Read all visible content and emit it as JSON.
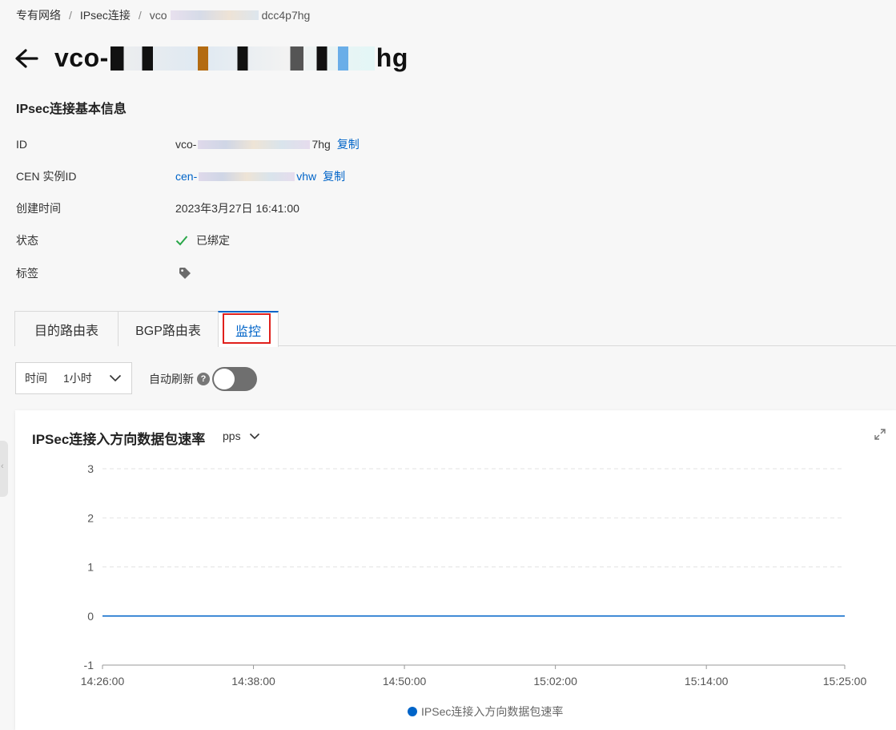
{
  "breadcrumb": {
    "items": [
      "专有网络",
      "IPsec连接",
      "vco"
    ],
    "tail": "dcc4p7hg"
  },
  "header": {
    "title_prefix": "vco-",
    "title_suffix": "hg"
  },
  "info": {
    "section_title": "IPsec连接基本信息",
    "id_label": "ID",
    "id_prefix": "vco-",
    "id_suffix": "7hg",
    "cen_label": "CEN 实例ID",
    "cen_prefix": "cen-",
    "cen_suffix": "vhw",
    "copy_label": "复制",
    "created_label": "创建时间",
    "created_value": "2023年3月27日 16:41:00",
    "status_label": "状态",
    "status_value": "已绑定",
    "tags_label": "标签"
  },
  "tabs": [
    {
      "label": "目的路由表"
    },
    {
      "label": "BGP路由表"
    },
    {
      "label": "监控"
    }
  ],
  "controls": {
    "time_label": "时间",
    "time_value": "1小时",
    "auto_refresh_label": "自动刷新",
    "help_glyph": "?",
    "auto_refresh_on": false
  },
  "chart": {
    "title": "IPSec连接入方向数据包速率",
    "unit": "pps",
    "legend": "IPSec连接入方向数据包速率"
  },
  "colors": {
    "accent": "#0064c8",
    "series": "#0064c8",
    "status_ok": "#2aa74a",
    "highlight": "#e0201c"
  },
  "chart_data": {
    "type": "line",
    "title": "IPSec连接入方向数据包速率",
    "x_ticks": [
      "14:26:00",
      "14:38:00",
      "14:50:00",
      "15:02:00",
      "15:14:00",
      "15:25:00"
    ],
    "y_ticks": [
      3,
      2,
      1,
      0,
      -1
    ],
    "ylim": [
      -1,
      3
    ],
    "grid": true,
    "legend_position": "bottom",
    "series": [
      {
        "name": "IPSec连接入方向数据包速率",
        "x": [
          "14:26:00",
          "15:25:00"
        ],
        "values": [
          0,
          0
        ]
      }
    ]
  }
}
